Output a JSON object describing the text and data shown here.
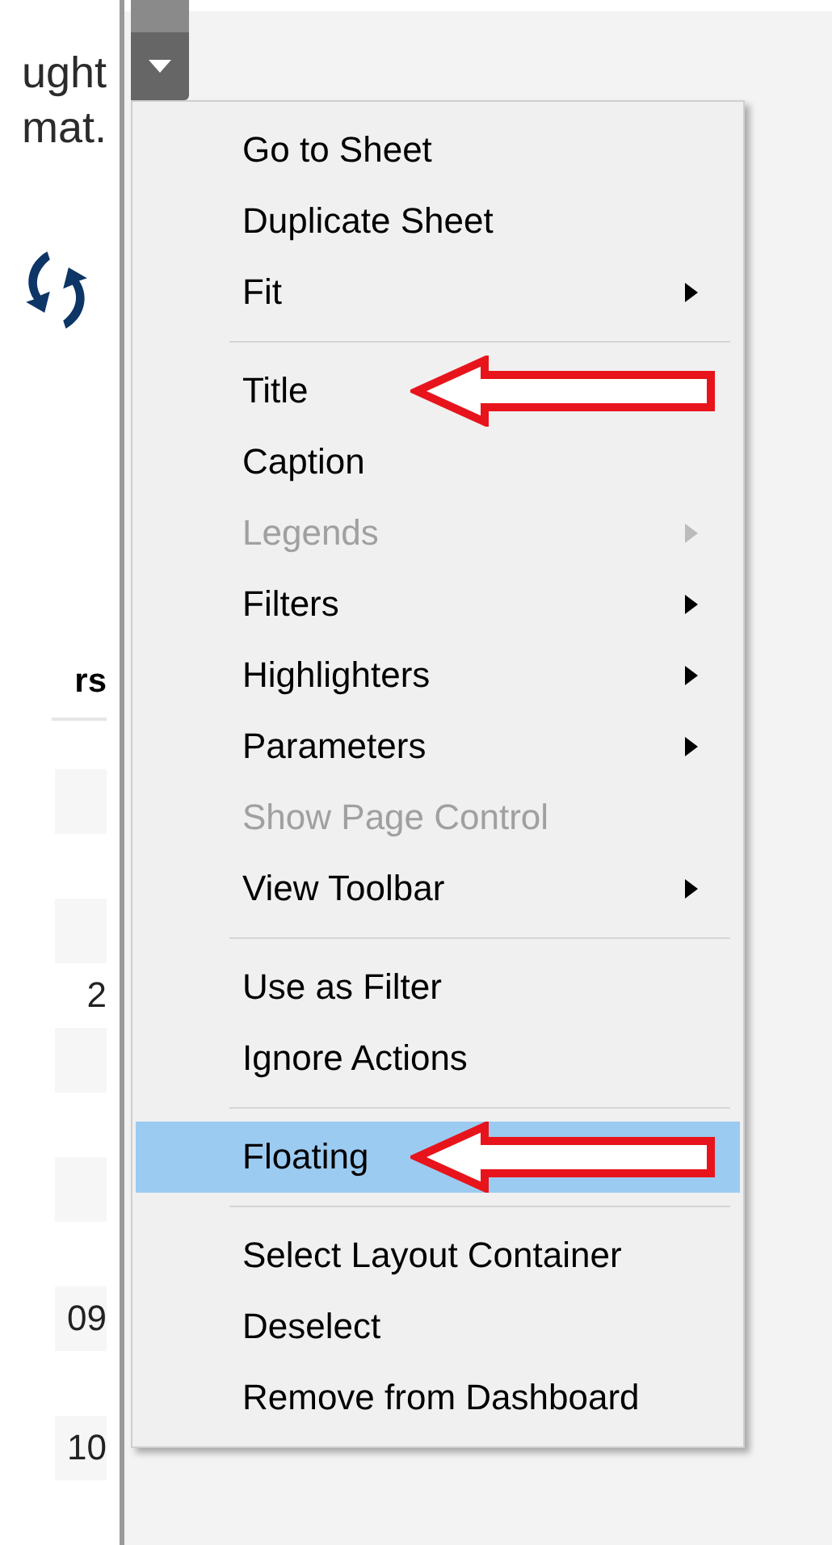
{
  "left_panel": {
    "text_lines": [
      "ught",
      "mat."
    ],
    "column_header": "rs",
    "cells": [
      {
        "text": ""
      },
      {
        "text": "",
        "after": "2"
      },
      {
        "text": ""
      },
      {
        "text": ""
      },
      {
        "text": "09"
      },
      {
        "text": "10"
      }
    ]
  },
  "context_menu": {
    "items": [
      {
        "kind": "item",
        "label": "Go to Sheet",
        "submenu": false,
        "disabled": false,
        "selected": false,
        "annotated": false
      },
      {
        "kind": "item",
        "label": "Duplicate Sheet",
        "submenu": false,
        "disabled": false,
        "selected": false,
        "annotated": false
      },
      {
        "kind": "item",
        "label": "Fit",
        "submenu": true,
        "disabled": false,
        "selected": false,
        "annotated": false
      },
      {
        "kind": "separator"
      },
      {
        "kind": "item",
        "label": "Title",
        "submenu": false,
        "disabled": false,
        "selected": false,
        "annotated": true
      },
      {
        "kind": "item",
        "label": "Caption",
        "submenu": false,
        "disabled": false,
        "selected": false,
        "annotated": false
      },
      {
        "kind": "item",
        "label": "Legends",
        "submenu": true,
        "disabled": true,
        "selected": false,
        "annotated": false
      },
      {
        "kind": "item",
        "label": "Filters",
        "submenu": true,
        "disabled": false,
        "selected": false,
        "annotated": false
      },
      {
        "kind": "item",
        "label": "Highlighters",
        "submenu": true,
        "disabled": false,
        "selected": false,
        "annotated": false
      },
      {
        "kind": "item",
        "label": "Parameters",
        "submenu": true,
        "disabled": false,
        "selected": false,
        "annotated": false
      },
      {
        "kind": "item",
        "label": "Show Page Control",
        "submenu": false,
        "disabled": true,
        "selected": false,
        "annotated": false
      },
      {
        "kind": "item",
        "label": "View Toolbar",
        "submenu": true,
        "disabled": false,
        "selected": false,
        "annotated": false
      },
      {
        "kind": "separator"
      },
      {
        "kind": "item",
        "label": "Use as Filter",
        "submenu": false,
        "disabled": false,
        "selected": false,
        "annotated": false
      },
      {
        "kind": "item",
        "label": "Ignore Actions",
        "submenu": false,
        "disabled": false,
        "selected": false,
        "annotated": false
      },
      {
        "kind": "separator"
      },
      {
        "kind": "item",
        "label": "Floating",
        "submenu": false,
        "disabled": false,
        "selected": true,
        "annotated": true
      },
      {
        "kind": "separator"
      },
      {
        "kind": "item",
        "label": "Select Layout Container",
        "submenu": false,
        "disabled": false,
        "selected": false,
        "annotated": false
      },
      {
        "kind": "item",
        "label": "Deselect",
        "submenu": false,
        "disabled": false,
        "selected": false,
        "annotated": false
      },
      {
        "kind": "item",
        "label": "Remove from Dashboard",
        "submenu": false,
        "disabled": false,
        "selected": false,
        "annotated": false
      }
    ]
  }
}
